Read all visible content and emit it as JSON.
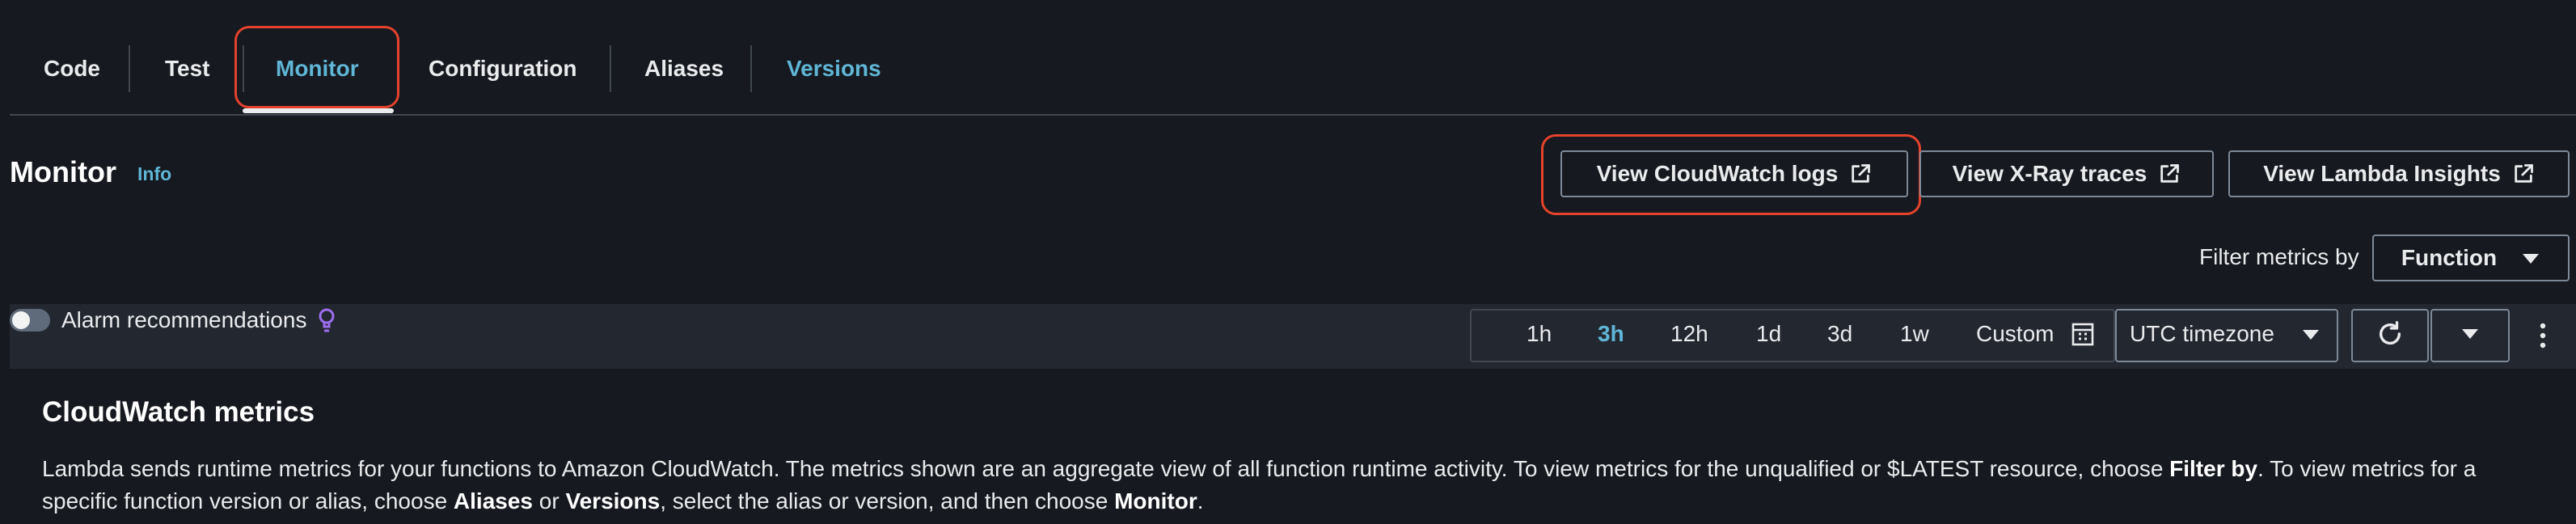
{
  "tabs": [
    {
      "label": "Code"
    },
    {
      "label": "Test"
    },
    {
      "label": "Monitor"
    },
    {
      "label": "Configuration"
    },
    {
      "label": "Aliases"
    },
    {
      "label": "Versions"
    }
  ],
  "active_tab": "Monitor",
  "header": {
    "title": "Monitor",
    "info_link": "Info",
    "buttons": {
      "cloudwatch_logs": "View CloudWatch logs",
      "xray_traces": "View X-Ray traces",
      "lambda_insights": "View Lambda Insights"
    }
  },
  "filter": {
    "label": "Filter metrics by",
    "value": "Function"
  },
  "toolbar": {
    "alarm_recommendations": "Alarm recommendations",
    "alarm_toggle_on": false,
    "time_ranges": [
      "1h",
      "3h",
      "12h",
      "1d",
      "3d",
      "1w"
    ],
    "selected_range": "3h",
    "custom_label": "Custom",
    "timezone": "UTC timezone"
  },
  "section": {
    "title": "CloudWatch metrics",
    "desc_1": "Lambda sends runtime metrics for your functions to Amazon CloudWatch. The metrics shown are an aggregate view of all function runtime activity. To view metrics for the unqualified or $LATEST resource, choose ",
    "desc_2": "Filter by",
    "desc_3": ". To view metrics for a specific function version or alias, choose ",
    "desc_4": "Aliases",
    "desc_5": " or ",
    "desc_6": "Versions",
    "desc_7": ", select the alias or version, and then choose ",
    "desc_8": "Monitor",
    "desc_9": "."
  },
  "colors": {
    "background": "#16191f",
    "toolbar_band": "#232730",
    "link_blue": "#5fb6d6",
    "highlight_red": "#e4422c",
    "bulb_purple": "#9d6ef0"
  },
  "icons": [
    "external-link-icon",
    "caret-down-icon",
    "calendar-icon",
    "refresh-icon",
    "more-vertical-icon",
    "lightbulb-icon"
  ]
}
